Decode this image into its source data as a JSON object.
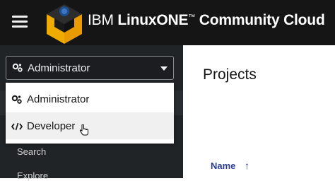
{
  "header": {
    "brand_ibm": "IBM",
    "brand_product": "LinuxONE",
    "brand_tm": "™",
    "brand_rest": "Community Cloud"
  },
  "perspective": {
    "selected": "Administrator",
    "options": [
      {
        "label": "Administrator",
        "icon": "cogs-icon"
      },
      {
        "label": "Developer",
        "icon": "code-icon"
      }
    ],
    "hovered_index": 1
  },
  "sidebar": {
    "items": [
      {
        "label": "Search"
      },
      {
        "label": "Explore"
      }
    ]
  },
  "main": {
    "title": "Projects",
    "column_header": "Name",
    "sort_indicator": "↑"
  },
  "colors": {
    "topbar": "#151515",
    "sidebar": "#212427",
    "link_blue": "#2b3d93",
    "logo_yellow": "#f0ab00"
  }
}
